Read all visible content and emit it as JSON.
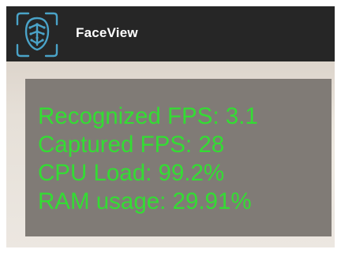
{
  "app": {
    "title": "FaceView",
    "logo_icon": "face-scan-icon",
    "accent_color": "#4aa3c8"
  },
  "stats": {
    "text_color": "#33dd33",
    "lines": [
      "Recognized FPS: 3.1",
      "Captured FPS: 28",
      "CPU Load: 99.2%",
      "RAM usage: 29.91%"
    ]
  }
}
